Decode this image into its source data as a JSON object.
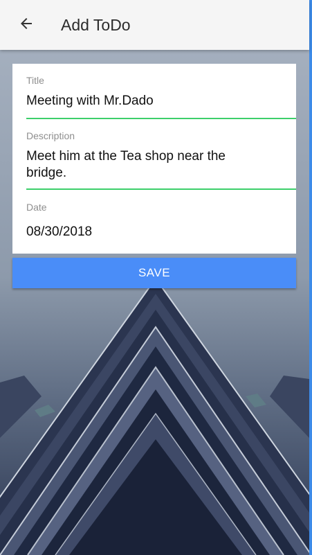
{
  "appbar": {
    "title": "Add ToDo",
    "back_icon": "arrow-back-icon"
  },
  "form": {
    "title_label": "Title",
    "title_value": "Meeting with Mr.Dado",
    "description_label": "Description",
    "description_value": "Meet him at the Tea shop near the bridge.",
    "date_label": "Date",
    "date_value": "08/30/2018"
  },
  "save_button": {
    "label": "SAVE"
  },
  "colors": {
    "appbar_bg": "#f5f5f5",
    "accent_underline": "#3ccf6a",
    "button_bg": "#4a8df8",
    "edge_blue": "#3d8be8"
  }
}
